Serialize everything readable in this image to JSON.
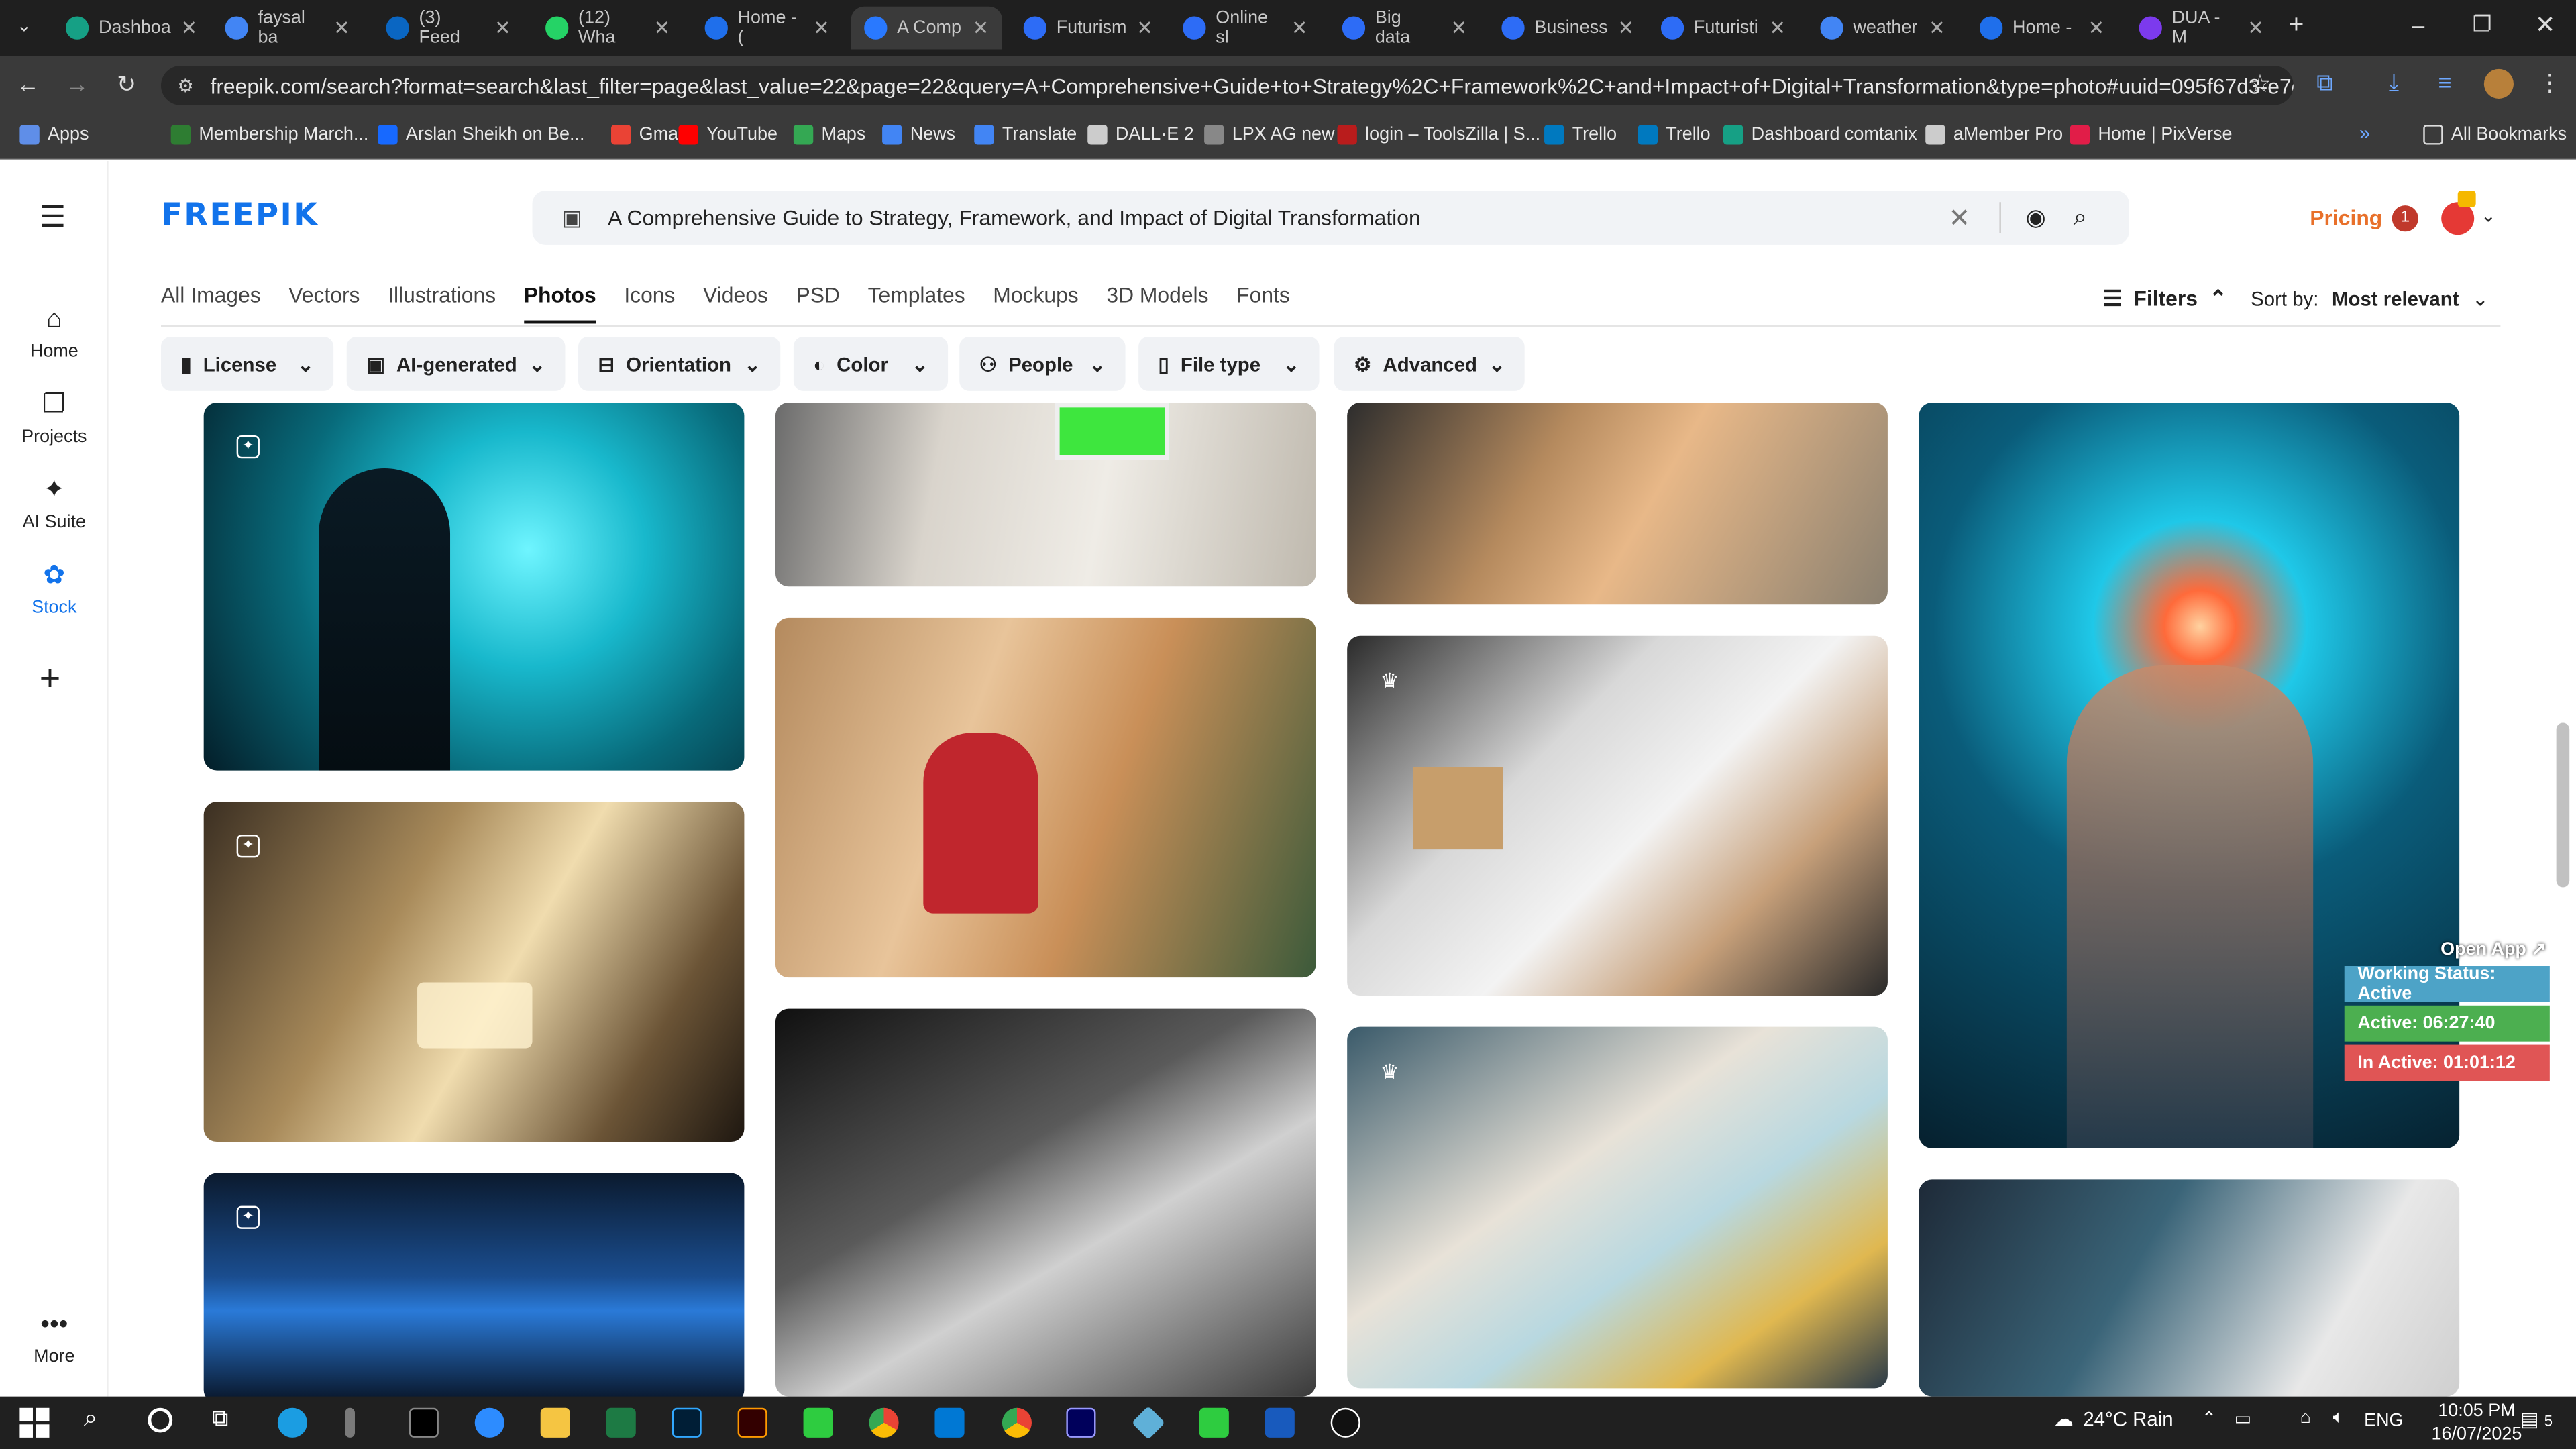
{
  "browser": {
    "tabs": [
      {
        "label": "Dashboa",
        "color": "#16a085"
      },
      {
        "label": "faysal ba",
        "color": "#4285f4"
      },
      {
        "label": "(3) Feed",
        "color": "#0a66c2"
      },
      {
        "label": "(12) Wha",
        "color": "#25d366"
      },
      {
        "label": "Home - (",
        "color": "#1f6feb"
      },
      {
        "label": "A Comp",
        "color": "#2979ff"
      },
      {
        "label": "Futurism",
        "color": "#2d6cf6"
      },
      {
        "label": "Online sl",
        "color": "#2d6cf6"
      },
      {
        "label": "Big data",
        "color": "#2d6cf6"
      },
      {
        "label": "Business",
        "color": "#2d6cf6"
      },
      {
        "label": "Futuristi",
        "color": "#2d6cf6"
      },
      {
        "label": "weather",
        "color": "#4285f4"
      },
      {
        "label": "Home -",
        "color": "#1f6feb"
      },
      {
        "label": "DUA - M",
        "color": "#7c3aed"
      }
    ],
    "url": "freepik.com/search?format=search&last_filter=page&last_value=22&page=22&query=A+Comprehensive+Guide+to+Strategy%2C+Framework%2C+and+Impact+of+Digital+Transformation&type=photo#uuid=095f67d3-e7ea-4500-be7d-a4...",
    "bookmarks": [
      {
        "label": "Apps",
        "color": "#5f8ee8"
      },
      {
        "label": "Membership March...",
        "color": "#2e7d32"
      },
      {
        "label": "Arslan Sheikh on Be...",
        "color": "#1769ff"
      },
      {
        "label": "Gmail",
        "color": "#ea4335"
      },
      {
        "label": "YouTube",
        "color": "#ff0000"
      },
      {
        "label": "Maps",
        "color": "#34a853"
      },
      {
        "label": "News",
        "color": "#4285f4"
      },
      {
        "label": "Translate",
        "color": "#4285f4"
      },
      {
        "label": "DALL·E 2",
        "color": "#cccccc"
      },
      {
        "label": "LPX AG new",
        "color": "#888888"
      },
      {
        "label": "login – ToolsZilla | S...",
        "color": "#b91c1c"
      },
      {
        "label": "Trello",
        "color": "#0079bf"
      },
      {
        "label": "Trello",
        "color": "#0079bf"
      },
      {
        "label": "Dashboard comtanix",
        "color": "#16a085"
      },
      {
        "label": "aMember Pro",
        "color": "#cccccc"
      },
      {
        "label": "Home | PixVerse",
        "color": "#e11d48"
      }
    ],
    "all_bookmarks": "All Bookmarks"
  },
  "site": {
    "logo": "FREEPIK",
    "search_query": "A Comprehensive Guide to Strategy, Framework, and Impact of Digital Transformation",
    "pricing": "Pricing",
    "notification_count": "1",
    "sidebar": [
      {
        "label": "Home",
        "icon": "home-icon",
        "glyph": "⌂"
      },
      {
        "label": "Projects",
        "icon": "projects-icon",
        "glyph": "❐"
      },
      {
        "label": "AI Suite",
        "icon": "ai-suite-icon",
        "glyph": "✦"
      },
      {
        "label": "Stock",
        "icon": "stock-icon",
        "glyph": "✿"
      }
    ],
    "more": "More",
    "type_tabs": [
      "All Images",
      "Vectors",
      "Illustrations",
      "Photos",
      "Icons",
      "Videos",
      "PSD",
      "Templates",
      "Mockups",
      "3D Models",
      "Fonts"
    ],
    "active_tab": "Photos",
    "filters_label": "Filters",
    "sort_label": "Sort by:",
    "sort_value": "Most relevant",
    "filter_chips": [
      {
        "label": "License",
        "icon": "license-icon",
        "glyph": "▮"
      },
      {
        "label": "AI-generated",
        "icon": "ai-generated-icon",
        "glyph": "▣"
      },
      {
        "label": "Orientation",
        "icon": "orientation-icon",
        "glyph": "⊟"
      },
      {
        "label": "Color",
        "icon": "color-icon",
        "glyph": "◐"
      },
      {
        "label": "People",
        "icon": "people-icon",
        "glyph": "⚇"
      },
      {
        "label": "File type",
        "icon": "file-type-icon",
        "glyph": "▯"
      },
      {
        "label": "Advanced",
        "icon": "advanced-icon",
        "glyph": "⚙"
      }
    ]
  },
  "widget": {
    "open_app": "Open App ↗",
    "working_status": "Working Status: Active",
    "active": "Active: 06:27:40",
    "inactive": "In Active: 01:01:12",
    "colors": {
      "status": "#4da3c7",
      "active": "#4caf50",
      "inactive": "#e05555"
    }
  },
  "taskbar": {
    "weather": "24°C Rain",
    "language": "ENG",
    "time": "10:05 PM",
    "date": "16/07/2025",
    "notification_badge": "5"
  }
}
